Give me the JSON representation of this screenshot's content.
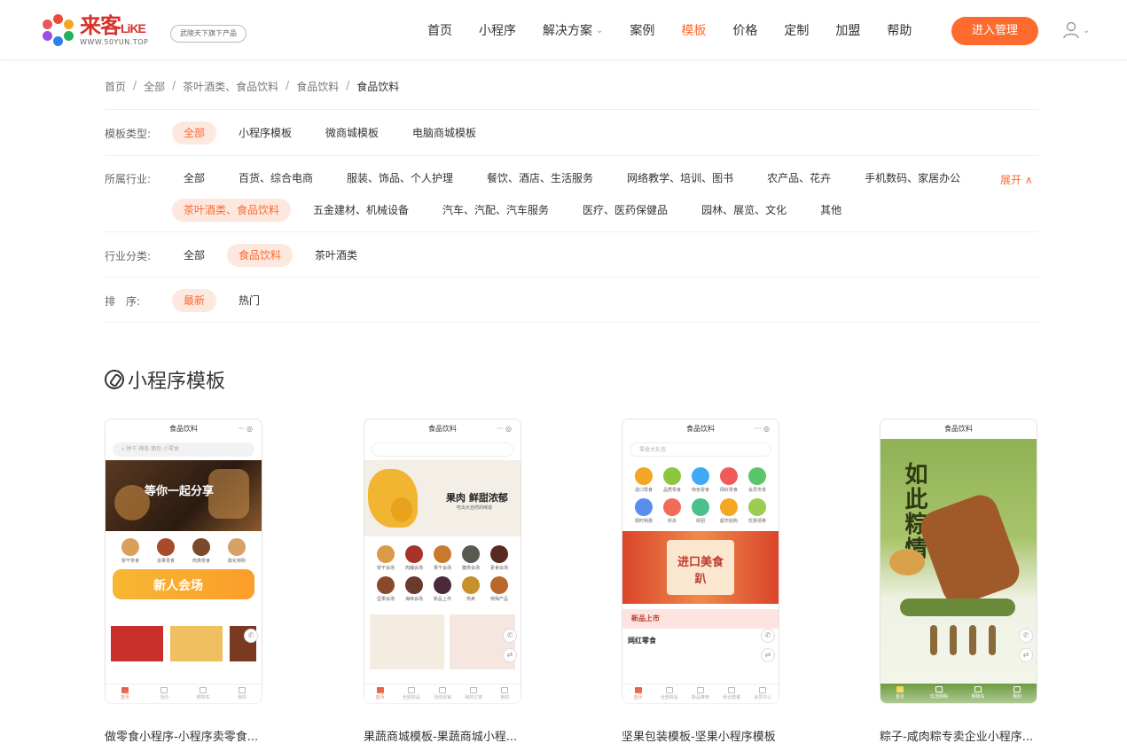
{
  "brand": {
    "logo_main": "来客",
    "logo_latin": "LiKE",
    "logo_sub": "WWW.50YUN.TOP",
    "slogan": "武陵天下旗下产品"
  },
  "nav": {
    "items": [
      "首页",
      "小程序",
      "解决方案",
      "案例",
      "模板",
      "价格",
      "定制",
      "加盟",
      "帮助"
    ],
    "active": "模板",
    "admin_button": "进入管理"
  },
  "breadcrumb": [
    "首页",
    "全部",
    "茶叶酒类、食品饮料",
    "食品饮料",
    "食品饮料"
  ],
  "filters": {
    "template_type": {
      "label": "模板类型:",
      "options": [
        "全部",
        "小程序模板",
        "微商城模板",
        "电脑商城模板"
      ],
      "active": "全部"
    },
    "industry": {
      "label": "所属行业:",
      "row1": [
        "全部",
        "百货、综合电商",
        "服装、饰品、个人护理",
        "餐饮、酒店、生活服务",
        "网络教学、培训、图书",
        "农产品、花卉",
        "手机数码、家居办公"
      ],
      "row2": [
        "茶叶酒类、食品饮料",
        "五金建材、机械设备",
        "汽车、汽配、汽车服务",
        "医疗、医药保健品",
        "园林、展览、文化",
        "其他"
      ],
      "active": "茶叶酒类、食品饮料",
      "expand": "展开 ∧"
    },
    "category": {
      "label": "行业分类:",
      "options": [
        "全部",
        "食品饮料",
        "茶叶酒类"
      ],
      "active": "食品饮料"
    },
    "sort": {
      "label": "排　序:",
      "options": [
        "最新",
        "热门"
      ],
      "active": "最新"
    }
  },
  "section_title": "小程序模板",
  "cards": [
    {
      "title": "做零食小程序-小程序卖零食...",
      "phone_title": "食品饮料",
      "search": "饼干 辣条 面包 小零食",
      "banner": "等你一起分享",
      "promo": "新人会场",
      "cats": [
        "饼干零食",
        "进果零食",
        "肉类零食",
        "膨化特购"
      ],
      "tabs": [
        "首页",
        "活动",
        "购物车",
        "我的"
      ]
    },
    {
      "title": "果蔬商城模板-果蔬商城小程...",
      "phone_title": "食品饮料",
      "banner": "果肉 鲜甜浓郁",
      "banner_sub": "吃出大自然的味道",
      "cats": [
        "饼干会场",
        "肉脯会场",
        "果干会场",
        "糖类会场",
        "素食会场",
        "坚果会场",
        "海味会场",
        "新品上市",
        "热卖",
        "特殊产品"
      ],
      "tabs": [
        "首页",
        "全部商品",
        "活动促销",
        "我的订单",
        "我的"
      ]
    },
    {
      "title": "坚果包装模板-坚果小程序模板",
      "phone_title": "食品饮料",
      "search": "零食大礼包",
      "banner": "进口美食趴",
      "strip": "新品上市",
      "section": "网红零食",
      "cats": [
        "进口零食",
        "品质零食",
        "特色零食",
        "网红零食",
        "会员专享",
        "限时特惠",
        "秒杀",
        "拼团",
        "超市抢购",
        "优惠领券"
      ],
      "tabs": [
        "首页",
        "全部商品",
        "新品推荐",
        "组合套餐",
        "会员中心"
      ]
    },
    {
      "title": "粽子-咸肉粽专卖企业小程序...",
      "phone_title": "食品饮料",
      "banner": "如此粽情",
      "tabs": [
        "首页",
        "优选网购",
        "购物车",
        "我的"
      ]
    }
  ],
  "colors": {
    "accent": "#ff6a2e",
    "chip_bg": "#fde8e0",
    "text": "#333333"
  }
}
